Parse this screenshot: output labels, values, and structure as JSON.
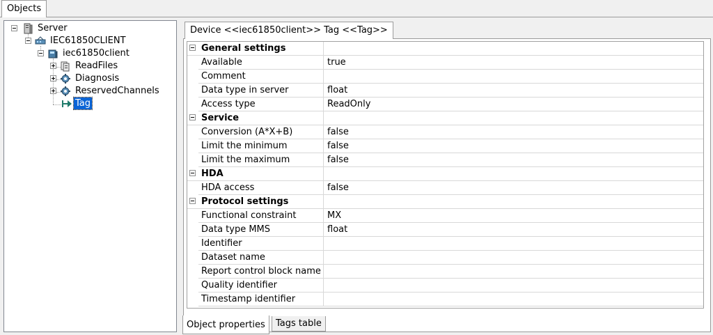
{
  "top_tab": {
    "label": "Objects"
  },
  "tree": {
    "server": "Server",
    "client_group": "IEC61850CLIENT",
    "device": "iec61850client",
    "readfiles": "ReadFiles",
    "diagnosis": "Diagnosis",
    "reserved": "ReservedChannels",
    "tag": "Tag"
  },
  "doc_tab": {
    "label": "Device <<iec61850client>> Tag <<Tag>>"
  },
  "properties": {
    "general": {
      "title": "General settings",
      "available": {
        "name": "Available",
        "value": "true"
      },
      "comment": {
        "name": "Comment",
        "value": ""
      },
      "data_type_server": {
        "name": "Data type in server",
        "value": "float"
      },
      "access_type": {
        "name": "Access type",
        "value": "ReadOnly"
      }
    },
    "service": {
      "title": "Service",
      "conversion": {
        "name": "Conversion (A*X+B)",
        "value": "false"
      },
      "limit_min": {
        "name": "Limit the minimum",
        "value": "false"
      },
      "limit_max": {
        "name": "Limit the maximum",
        "value": "false"
      }
    },
    "hda": {
      "title": "HDA",
      "hda_access": {
        "name": "HDA access",
        "value": "false"
      }
    },
    "protocol": {
      "title": "Protocol settings",
      "functional_constraint": {
        "name": "Functional constraint",
        "value": "MX"
      },
      "data_type_mms": {
        "name": "Data type MMS",
        "value": "float"
      },
      "identifier": {
        "name": "Identifier",
        "value": ""
      },
      "dataset_name": {
        "name": "Dataset name",
        "value": ""
      },
      "report_cb_name": {
        "name": "Report control block name",
        "value": ""
      },
      "quality_identifier": {
        "name": "Quality identifier",
        "value": ""
      },
      "timestamp_identifier": {
        "name": "Timestamp identifier",
        "value": ""
      }
    }
  },
  "bottom_tabs": {
    "object_properties": "Object properties",
    "tags_table": "Tags table"
  },
  "colors": {
    "selection": "#0a64d6",
    "border": "#9a9a9a",
    "window_bg": "#f0f0f0"
  }
}
